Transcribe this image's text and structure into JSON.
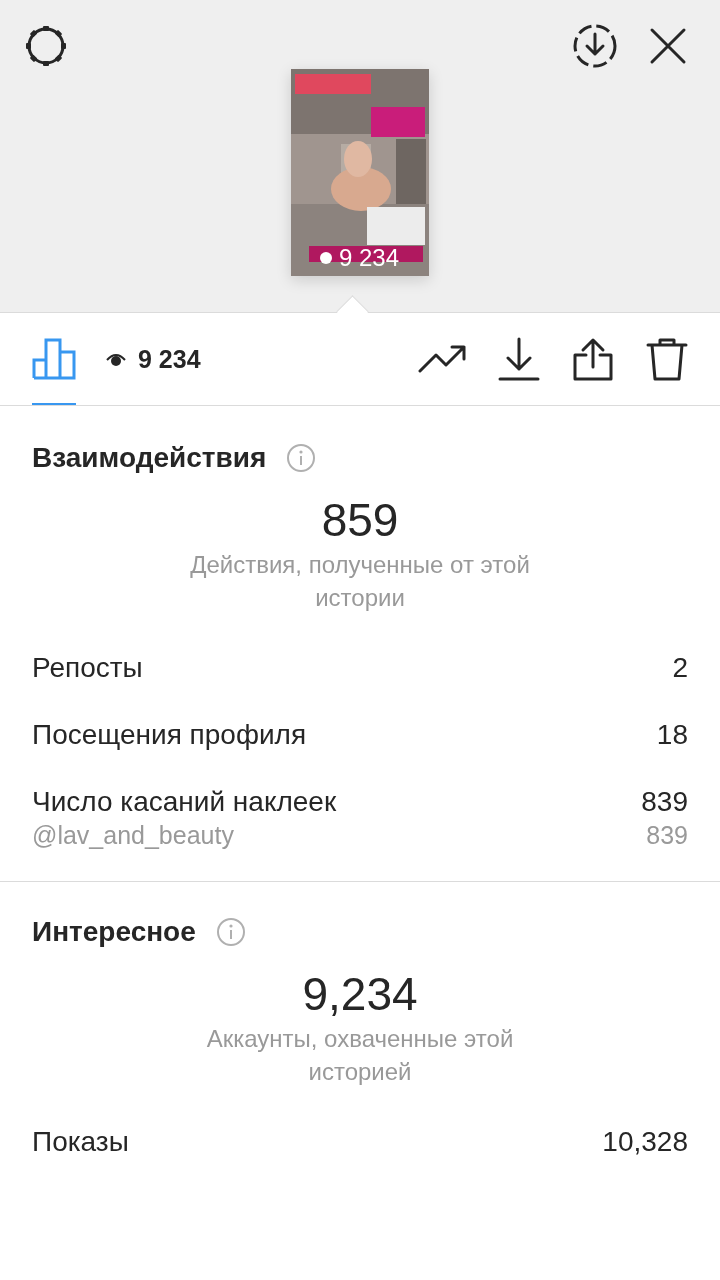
{
  "story": {
    "views": "9 234"
  },
  "tabs": [
    {
      "kind": "insights",
      "selected": true
    },
    {
      "kind": "views",
      "label": "9 234",
      "selected": false
    }
  ],
  "actions": [
    {
      "kind": "trend"
    },
    {
      "kind": "download"
    },
    {
      "kind": "share"
    },
    {
      "kind": "delete"
    }
  ],
  "sections": [
    {
      "title": "Взаимодействия",
      "total": "859",
      "caption": "Действия, полученные от этой истории",
      "rows": [
        {
          "kind": "main",
          "label": "Репосты",
          "value": "2"
        },
        {
          "kind": "main",
          "label": "Посещения профиля",
          "value": "18"
        },
        {
          "kind": "main",
          "label": "Число касаний наклеек",
          "value": "839"
        },
        {
          "kind": "sub",
          "label": "@lav_and_beauty",
          "value": "839"
        }
      ]
    },
    {
      "title": "Интересное",
      "total": "9,234",
      "caption": "Аккаунты, охваченные этой историей",
      "rows": [
        {
          "kind": "main",
          "label": "Показы",
          "value": "10,328"
        }
      ]
    }
  ]
}
